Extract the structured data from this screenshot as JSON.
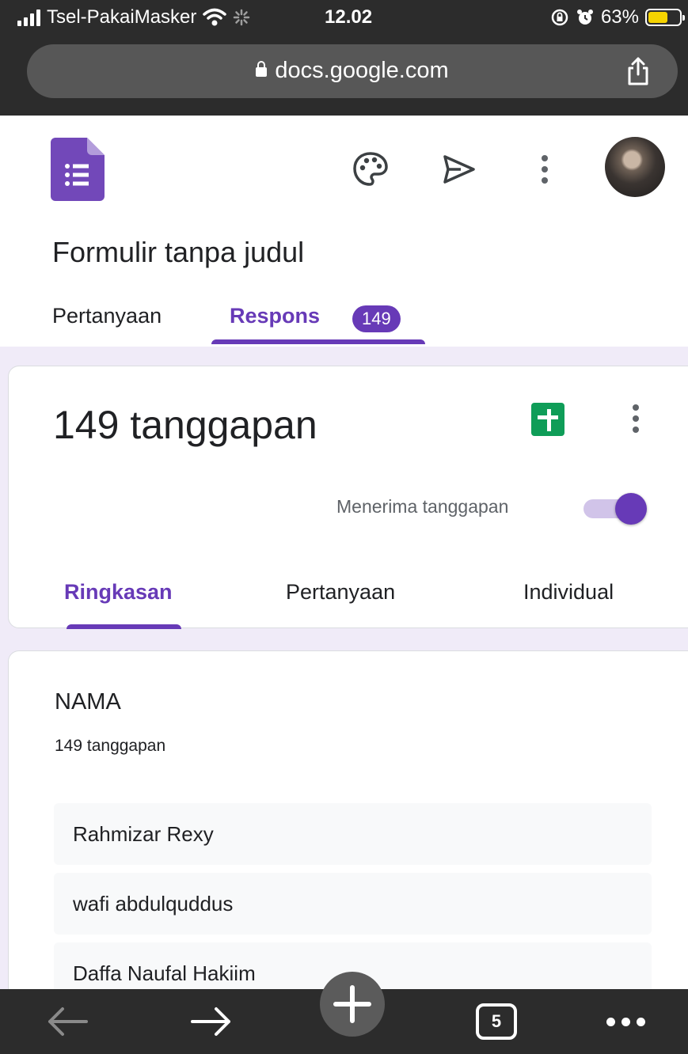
{
  "status_bar": {
    "carrier": "Tsel-PakaiMasker",
    "time": "12.02",
    "battery": "63%",
    "battery_level": 0.63
  },
  "browser": {
    "url": "docs.google.com",
    "open_tabs": "5"
  },
  "form": {
    "title": "Formulir tanpa judul",
    "tabs": {
      "questions": "Pertanyaan",
      "responses": "Respons",
      "responses_badge": "149"
    }
  },
  "summary": {
    "count_label": "149 tanggapan",
    "accepting_label": "Menerima tanggapan",
    "accepting": true,
    "subtabs": [
      "Ringkasan",
      "Pertanyaan",
      "Individual"
    ]
  },
  "question": {
    "title": "NAMA",
    "count": "149 tanggapan",
    "responses": [
      "Rahmizar Rexy",
      "wafi abdulquddus",
      "Daffa Naufal Hakiim"
    ]
  },
  "colors": {
    "accent": "#673ab7",
    "sheets_green": "#0f9d58",
    "page_bg": "#f0ebf8",
    "browser_chrome": "#2c2c2c"
  }
}
